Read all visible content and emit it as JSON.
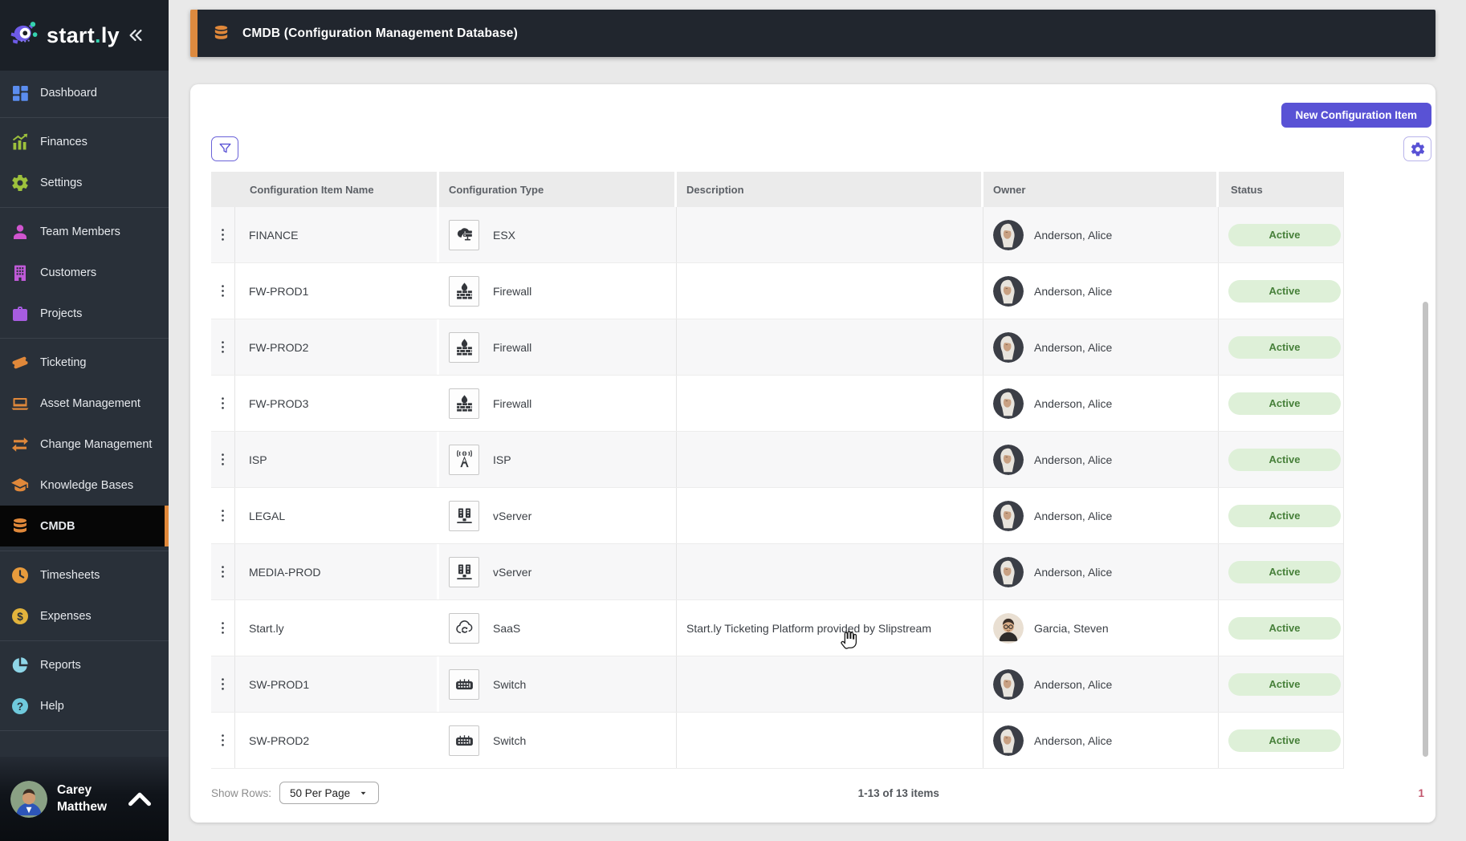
{
  "sidebar": {
    "logo_text": "start.ly",
    "items": [
      {
        "label": "Dashboard",
        "icon": "dashboard",
        "color": "#5b8def",
        "active": false,
        "divider_after": true
      },
      {
        "label": "Finances",
        "icon": "finances-chart",
        "color": "#9dc13c",
        "active": false,
        "divider_after": false
      },
      {
        "label": "Settings",
        "icon": "gear",
        "color": "#9dc13c",
        "active": false,
        "divider_after": true
      },
      {
        "label": "Team Members",
        "icon": "person",
        "color": "#d055cf",
        "active": false,
        "divider_after": false
      },
      {
        "label": "Customers",
        "icon": "building",
        "color": "#c05ad8",
        "active": false,
        "divider_after": false
      },
      {
        "label": "Projects",
        "icon": "briefcase",
        "color": "#a75ce0",
        "active": false,
        "divider_after": true
      },
      {
        "label": "Ticketing",
        "icon": "ticket",
        "color": "#e0883a",
        "active": false,
        "divider_after": false
      },
      {
        "label": "Asset Management",
        "icon": "laptop",
        "color": "#e0883a",
        "active": false,
        "divider_after": false
      },
      {
        "label": "Change Management",
        "icon": "change-arrows",
        "color": "#e0883a",
        "active": false,
        "divider_after": false
      },
      {
        "label": "Knowledge Bases",
        "icon": "graduation-cap",
        "color": "#e0883a",
        "active": false,
        "divider_after": false
      },
      {
        "label": "CMDB",
        "icon": "database",
        "color": "#e0883a",
        "active": true,
        "divider_after": true
      },
      {
        "label": "Timesheets",
        "icon": "clock",
        "color": "#e89b3c",
        "active": false,
        "divider_after": false
      },
      {
        "label": "Expenses",
        "icon": "dollar-circle",
        "color": "#e2b33c",
        "active": false,
        "divider_after": true
      },
      {
        "label": "Reports",
        "icon": "pie-chart",
        "color": "#8ed6e8",
        "active": false,
        "divider_after": false
      },
      {
        "label": "Help",
        "icon": "help-circle",
        "color": "#6fc9dc",
        "active": false,
        "divider_after": true
      }
    ],
    "user": {
      "first_name": "Carey",
      "last_name": "Matthew",
      "avatar": "avatar-carey"
    }
  },
  "header": {
    "title": "CMDB (Configuration Management Database)",
    "icon": "database",
    "accent_color": "#dd8a3f"
  },
  "toolbar": {
    "new_item_label": "New Configuration Item"
  },
  "table": {
    "columns": [
      "Configuration Item Name",
      "Configuration Type",
      "Description",
      "Owner",
      "Status"
    ],
    "rows": [
      {
        "name": "FINANCE",
        "type": "ESX",
        "type_icon": "esx",
        "description": "",
        "owner": "Anderson, Alice",
        "owner_avatar": "avatar-alice",
        "status": "Active"
      },
      {
        "name": "FW-PROD1",
        "type": "Firewall",
        "type_icon": "firewall",
        "description": "",
        "owner": "Anderson, Alice",
        "owner_avatar": "avatar-alice",
        "status": "Active"
      },
      {
        "name": "FW-PROD2",
        "type": "Firewall",
        "type_icon": "firewall",
        "description": "",
        "owner": "Anderson, Alice",
        "owner_avatar": "avatar-alice",
        "status": "Active"
      },
      {
        "name": "FW-PROD3",
        "type": "Firewall",
        "type_icon": "firewall",
        "description": "",
        "owner": "Anderson, Alice",
        "owner_avatar": "avatar-alice",
        "status": "Active"
      },
      {
        "name": "ISP",
        "type": "ISP",
        "type_icon": "isp",
        "description": "",
        "owner": "Anderson, Alice",
        "owner_avatar": "avatar-alice",
        "status": "Active"
      },
      {
        "name": "LEGAL",
        "type": "vServer",
        "type_icon": "vserver",
        "description": "",
        "owner": "Anderson, Alice",
        "owner_avatar": "avatar-alice",
        "status": "Active"
      },
      {
        "name": "MEDIA-PROD",
        "type": "vServer",
        "type_icon": "vserver",
        "description": "",
        "owner": "Anderson, Alice",
        "owner_avatar": "avatar-alice",
        "status": "Active"
      },
      {
        "name": "Start.ly",
        "type": "SaaS",
        "type_icon": "saas",
        "description": "Start.ly Ticketing Platform provided by Slipstream",
        "owner": "Garcia, Steven",
        "owner_avatar": "avatar-steven",
        "status": "Active"
      },
      {
        "name": "SW-PROD1",
        "type": "Switch",
        "type_icon": "switch",
        "description": "",
        "owner": "Anderson, Alice",
        "owner_avatar": "avatar-alice",
        "status": "Active"
      },
      {
        "name": "SW-PROD2",
        "type": "Switch",
        "type_icon": "switch",
        "description": "",
        "owner": "Anderson, Alice",
        "owner_avatar": "avatar-alice",
        "status": "Active"
      }
    ]
  },
  "pagination": {
    "show_rows_label": "Show Rows:",
    "per_page": "50 Per Page",
    "range_text": "1-13 of 13 items",
    "page": "1"
  },
  "colors": {
    "sidebar_bg": "#293039",
    "sidebar_active_bg": "#060606",
    "accent_orange": "#e0883a",
    "primary_button": "#5952d5",
    "status_active_bg": "#def0d8",
    "status_active_text": "#47803a",
    "page_bg": "#e9e9e9",
    "table_header_bg": "#ebebeb",
    "row_stripe": "#f7f7f8"
  }
}
